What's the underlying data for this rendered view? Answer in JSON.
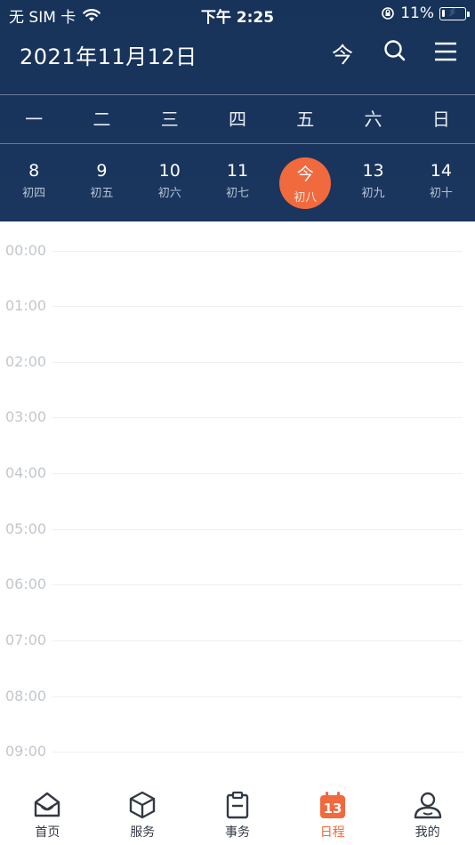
{
  "status_bar": {
    "carrier": "无 SIM 卡",
    "time": "下午 2:25",
    "battery": "11%",
    "battery_level": 0.11
  },
  "header": {
    "date_title": "2021年11月12日",
    "today_label": "今"
  },
  "week": {
    "weekdays": [
      "一",
      "二",
      "三",
      "四",
      "五",
      "六",
      "日"
    ],
    "dates": [
      {
        "day": "8",
        "lunar": "初四"
      },
      {
        "day": "9",
        "lunar": "初五"
      },
      {
        "day": "10",
        "lunar": "初六"
      },
      {
        "day": "11",
        "lunar": "初七"
      },
      {
        "day": "今",
        "lunar": "初八"
      },
      {
        "day": "13",
        "lunar": "初九"
      },
      {
        "day": "14",
        "lunar": "初十"
      }
    ],
    "selected_index": 4
  },
  "timeline": {
    "hours": [
      "00:00",
      "01:00",
      "02:00",
      "03:00",
      "04:00",
      "05:00",
      "06:00",
      "07:00",
      "08:00",
      "09:00"
    ]
  },
  "tabbar": {
    "tabs": [
      {
        "label": "首页",
        "icon": "home-icon"
      },
      {
        "label": "服务",
        "icon": "cube-icon"
      },
      {
        "label": "事务",
        "icon": "clipboard-icon"
      },
      {
        "label": "日程",
        "icon": "calendar-icon"
      },
      {
        "label": "我的",
        "icon": "user-icon"
      }
    ],
    "active_index": 3
  },
  "colors": {
    "header_bg": "#1b365e",
    "accent": "#f06a3e",
    "time_label": "#c2c7cd"
  }
}
